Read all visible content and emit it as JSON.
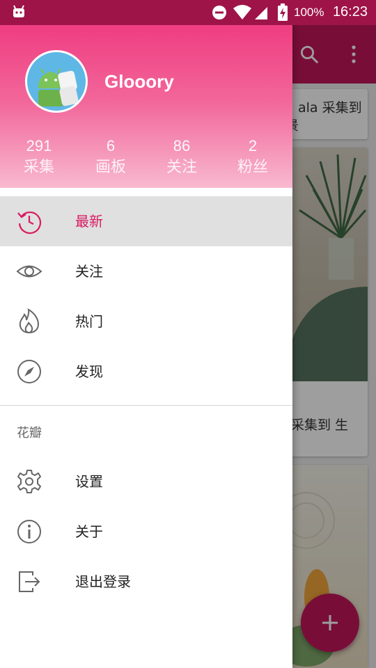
{
  "status_bar": {
    "time": "16:23",
    "battery_percent": "100%",
    "icons": [
      "android-icon",
      "dnd-icon",
      "wifi-icon",
      "signal-icon",
      "battery-charging-icon"
    ]
  },
  "background": {
    "toolbar_color": "#c2185b",
    "toolbar_icons": [
      "search-icon",
      "more-vert-icon"
    ],
    "card1_text_line1": "ala 采集到",
    "card1_text_line2": "景",
    "card2_text": "采集到 生",
    "fab_icon": "plus-icon"
  },
  "drawer": {
    "user": {
      "name": "Glooory",
      "avatar_icon": "android-marshmallow-avatar"
    },
    "stats": [
      {
        "value": "291",
        "label": "采集"
      },
      {
        "value": "6",
        "label": "画板"
      },
      {
        "value": "86",
        "label": "关注"
      },
      {
        "value": "2",
        "label": "粉丝"
      }
    ],
    "menu": [
      {
        "label": "最新",
        "icon": "history-icon",
        "active": true
      },
      {
        "label": "关注",
        "icon": "eye-icon",
        "active": false
      },
      {
        "label": "热门",
        "icon": "fire-icon",
        "active": false
      },
      {
        "label": "发现",
        "icon": "compass-icon",
        "active": false
      }
    ],
    "section_title": "花瓣",
    "secondary_menu": [
      {
        "label": "设置",
        "icon": "gear-icon"
      },
      {
        "label": "关于",
        "icon": "info-icon"
      },
      {
        "label": "退出登录",
        "icon": "logout-icon"
      }
    ]
  },
  "colors": {
    "accent": "#d81b60",
    "status_bar": "#9e1448",
    "header_top": "#ee2f79",
    "header_bottom": "#f8b9cf",
    "active_item_bg": "#e0e0e0"
  }
}
